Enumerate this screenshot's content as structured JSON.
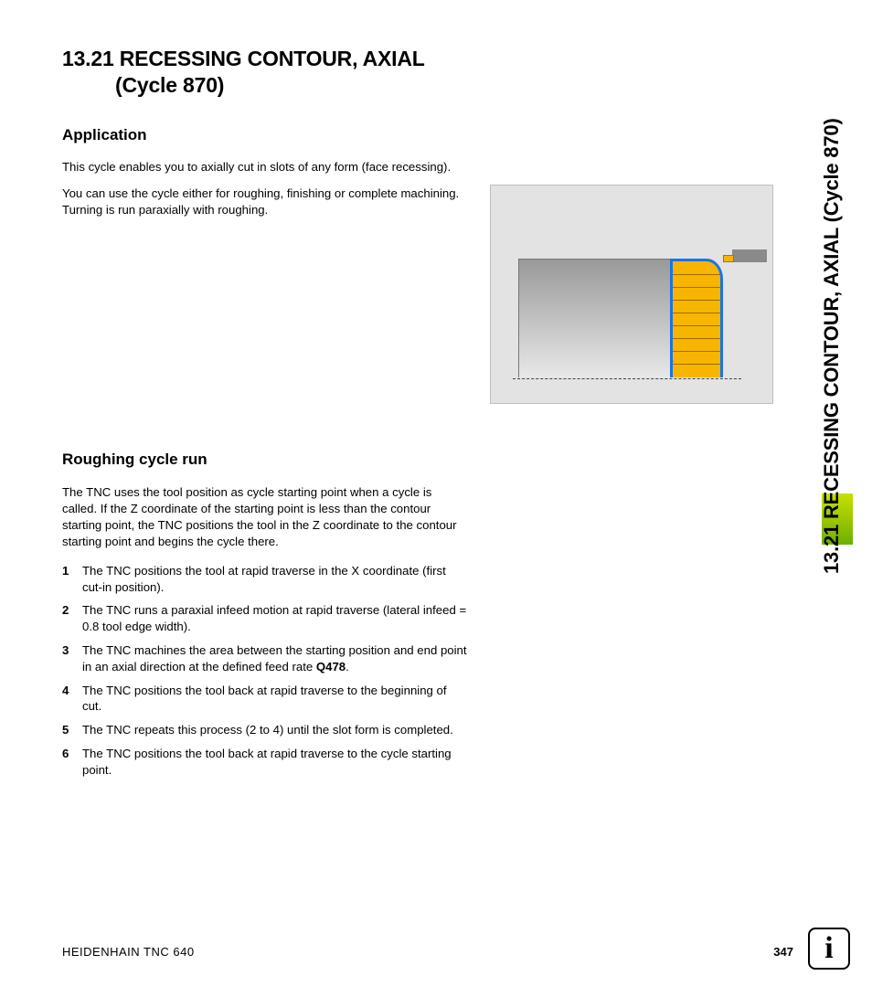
{
  "heading": {
    "number": "13.21",
    "title": "RECESSING CONTOUR, AXIAL",
    "subtitle": "(Cycle 870)"
  },
  "side_tab": "13.21 RECESSING CONTOUR, AXIAL (Cycle 870)",
  "application": {
    "heading": "Application",
    "para1": "This cycle enables you to axially cut in slots of any form (face recessing).",
    "para2": "You can use the cycle either for roughing, finishing or complete machining. Turning is run paraxially with roughing."
  },
  "roughing": {
    "heading": "Roughing cycle run",
    "intro": "The TNC uses the tool position as cycle starting point when a cycle is called. If the Z coordinate of the starting point is less than the contour starting point, the TNC positions the tool in the Z coordinate to the contour starting point and begins the cycle there.",
    "steps": [
      {
        "n": "1",
        "t": "The TNC positions the tool at rapid traverse in the X coordinate (first cut-in position)."
      },
      {
        "n": "2",
        "t": "The TNC runs a paraxial infeed motion at rapid traverse (lateral infeed = 0.8 tool edge width)."
      },
      {
        "n": "3",
        "t_pre": "The TNC machines the area between the starting position and end point in an axial direction at the defined feed rate ",
        "t_bold": "Q478",
        "t_post": "."
      },
      {
        "n": "4",
        "t": "The TNC positions the tool back at rapid traverse to the beginning of cut."
      },
      {
        "n": "5",
        "t": "The TNC repeats this process (2 to 4) until the slot form is completed."
      },
      {
        "n": "6",
        "t": "The TNC positions the tool back at rapid traverse to the cycle starting point."
      }
    ]
  },
  "footer": {
    "doc": "HEIDENHAIN TNC 640",
    "page": "347"
  }
}
